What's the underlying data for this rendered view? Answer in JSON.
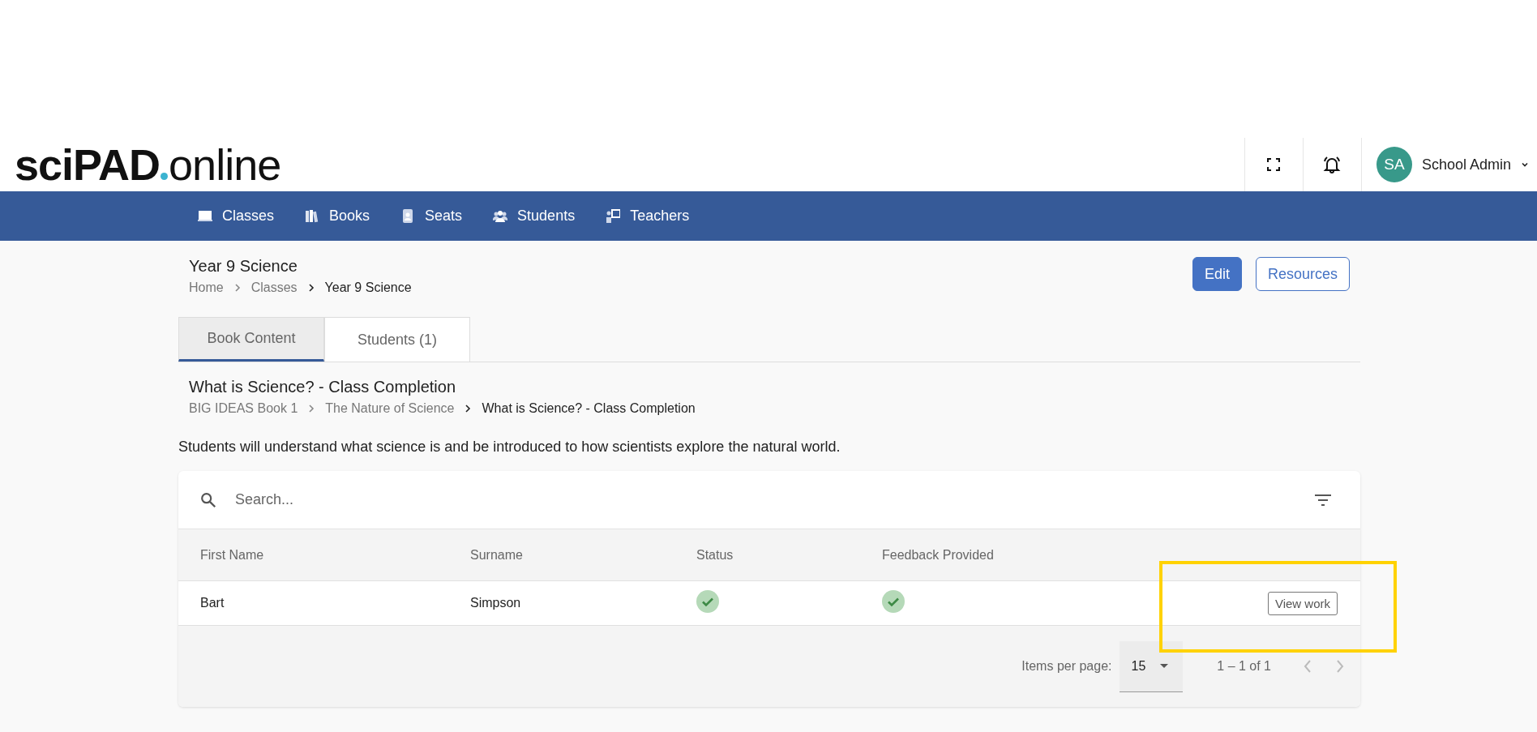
{
  "header": {
    "logo": {
      "bold": "sciPAD",
      "light": "online"
    },
    "user": {
      "initials": "SA",
      "name": "School Admin"
    }
  },
  "nav": [
    {
      "label": "Classes",
      "kind": "board"
    },
    {
      "label": "Books",
      "kind": "books"
    },
    {
      "label": "Seats",
      "kind": "badge"
    },
    {
      "label": "Students",
      "kind": "people"
    },
    {
      "label": "Teachers",
      "kind": "teacher"
    }
  ],
  "page": {
    "title": "Year 9 Science",
    "breadcrumbs": [
      "Home",
      "Classes",
      "Year 9 Science"
    ],
    "buttons": [
      {
        "label": "Edit",
        "kind": "primary"
      },
      {
        "label": "Resources",
        "kind": "outline"
      }
    ]
  },
  "tabs": [
    {
      "label": "Book Content",
      "selected": true
    },
    {
      "label": "Students (1)",
      "selected": false
    }
  ],
  "section": {
    "title": "What is Science? - Class Completion",
    "breadcrumbs": [
      "BIG IDEAS Book 1",
      "The Nature of Science",
      "What is Science? - Class Completion"
    ],
    "description": "Students will understand what science is and be introduced to how scientists explore the natural world."
  },
  "table": {
    "search": {
      "placeholder": "Search..."
    },
    "columns": [
      "First Name",
      "Surname",
      "Status",
      "Feedback Provided"
    ],
    "rows": [
      {
        "first_name": "Bart",
        "surname": "Simpson",
        "status": true,
        "feedback": true,
        "action": "View work"
      }
    ],
    "paginator": {
      "label": "Items per page:",
      "page_size": "15",
      "range": "1 – 1 of 1"
    }
  },
  "annotation": {
    "kind": "frame"
  }
}
